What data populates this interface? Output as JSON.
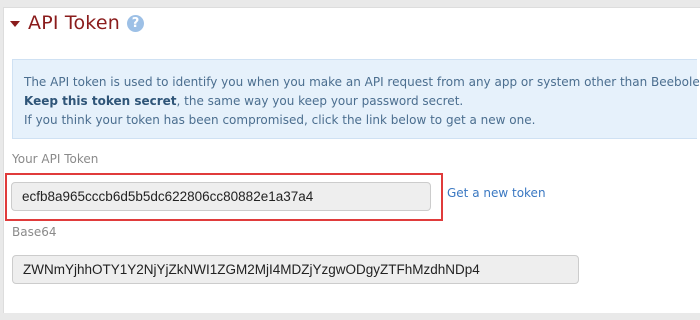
{
  "section": {
    "title": "API Token",
    "help_icon": "question-circle-icon"
  },
  "info": {
    "line1": "The API token is used to identify you when you make an API request from any app or system other than Beebole.",
    "line2_bold": "Keep this token secret",
    "line2_rest": ", the same way you keep your password secret.",
    "line3": "If you think your token has been compromised, click the link below to get a new one."
  },
  "token": {
    "label": "Your API Token",
    "value": "ecfb8a965cccb6d5b5dc622806cc80882e1a37a4",
    "new_token_link": "Get a new token"
  },
  "base64": {
    "label": "Base64",
    "value": "ZWNmYjhhOTY1Y2NjYjZkNWI1ZGM2MjI4MDZjYzgwODgyZTFhMzdhNDp4"
  },
  "colors": {
    "title": "#8a1c1c",
    "info_bg": "#e6f1fb",
    "highlight": "#e03b3b",
    "link": "#3a78c2"
  }
}
